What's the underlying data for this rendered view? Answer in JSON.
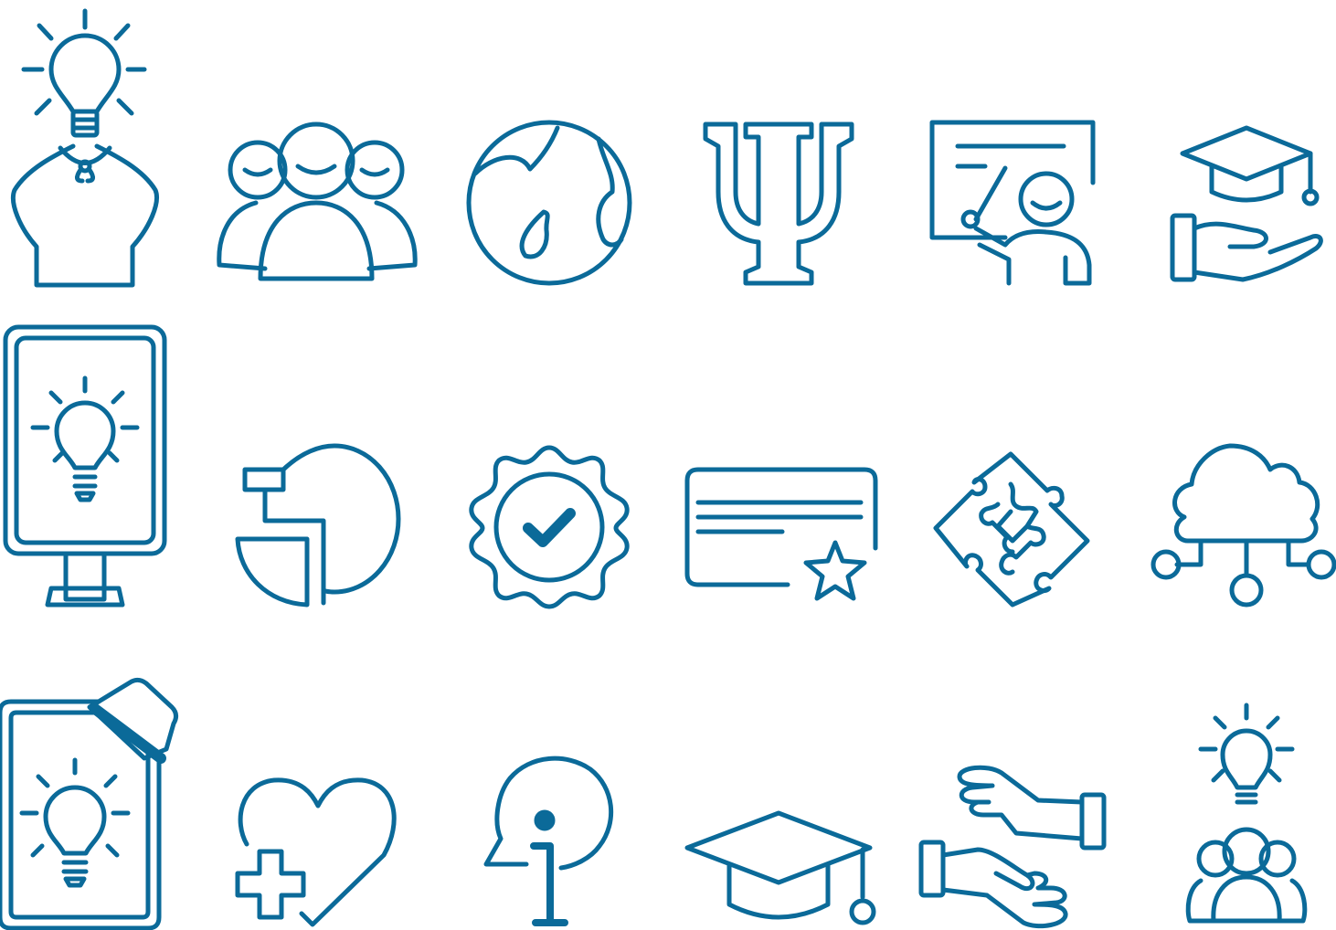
{
  "colors": {
    "icon": "#0b6a99",
    "background": "#ffffff"
  },
  "icons": [
    "idea-bust-icon",
    "group-people-icon",
    "globe-icon",
    "psi-icon",
    "teacher-board-icon",
    "graduation-hand-icon",
    "idea-screen-icon",
    "pie-chart-icon",
    "verified-badge-icon",
    "certificate-card-icon",
    "puzzle-icon",
    "cloud-network-icon",
    "idea-whiteboard-icon",
    "heart-plus-icon",
    "info-speech-icon",
    "graduation-cap-icon",
    "handshake-icon",
    "idea-team-icon"
  ]
}
